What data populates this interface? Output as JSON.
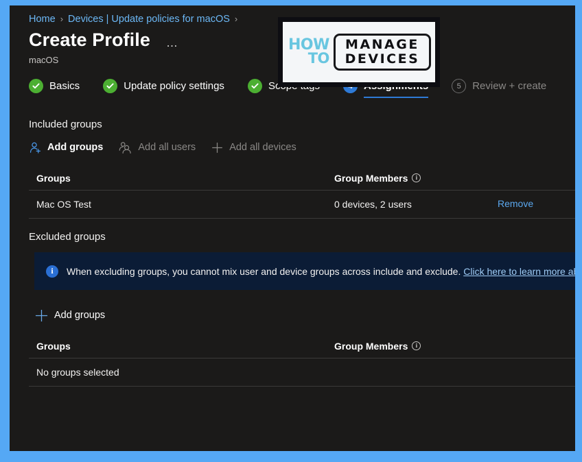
{
  "breadcrumb": {
    "items": [
      {
        "label": "Home",
        "icon": "none"
      },
      {
        "label": "Devices | Update policies for macOS",
        "icon": "none"
      }
    ],
    "separator": "›"
  },
  "header": {
    "title": "Create Profile",
    "subtitle": "macOS",
    "more_actions": "…"
  },
  "logo": {
    "line1": "HOW",
    "line2": "TO",
    "word1": "MANAGE",
    "word2": "DEVICES"
  },
  "wizard": {
    "steps": [
      {
        "label": "Basics",
        "state": "done",
        "badge": "✓"
      },
      {
        "label": "Update policy settings",
        "state": "done",
        "badge": "✓"
      },
      {
        "label": "Scope tags",
        "state": "done",
        "badge": "✓"
      },
      {
        "label": "Assignments",
        "state": "current",
        "badge": "4"
      },
      {
        "label": "Review + create",
        "state": "future",
        "badge": "5"
      }
    ]
  },
  "included": {
    "section_title": "Included groups",
    "commands": [
      {
        "label": "Add groups",
        "icon": "add-user-icon",
        "enabled": true
      },
      {
        "label": "Add all users",
        "icon": "all-users-icon",
        "enabled": false
      },
      {
        "label": "Add all devices",
        "icon": "plus-icon",
        "enabled": false
      }
    ],
    "columns": {
      "groups": "Groups",
      "members": "Group Members"
    },
    "rows": [
      {
        "group": "Mac OS Test",
        "members": "0 devices, 2 users",
        "action": "Remove"
      }
    ]
  },
  "banner": {
    "text": "When excluding groups, you cannot mix user and device groups across include and exclude.",
    "link": "Click here to learn more about",
    "icon": "info-icon"
  },
  "excluded": {
    "section_title": "Excluded groups",
    "commands": [
      {
        "label": "Add groups",
        "icon": "plus-icon",
        "enabled": true
      }
    ],
    "columns": {
      "groups": "Groups",
      "members": "Group Members"
    },
    "empty_text": "No groups selected"
  },
  "colors": {
    "accent_blue": "#2e7ad6",
    "link_blue": "#6cb8f6",
    "success_green": "#4caf32",
    "blade_background": "#1b1a19",
    "window_border": "#55a8f5",
    "banner_background": "#0b1c36"
  }
}
